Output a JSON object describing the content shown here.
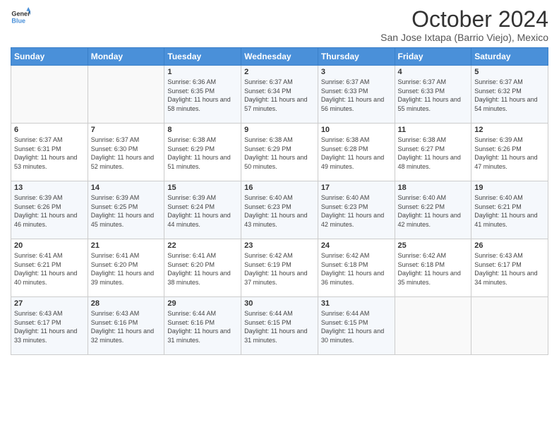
{
  "header": {
    "logo_line1": "General",
    "logo_line2": "Blue",
    "title": "October 2024",
    "subtitle": "San Jose Ixtapa (Barrio Viejo), Mexico"
  },
  "days_of_week": [
    "Sunday",
    "Monday",
    "Tuesday",
    "Wednesday",
    "Thursday",
    "Friday",
    "Saturday"
  ],
  "weeks": [
    [
      {
        "day": "",
        "sunrise": "",
        "sunset": "",
        "daylight": ""
      },
      {
        "day": "",
        "sunrise": "",
        "sunset": "",
        "daylight": ""
      },
      {
        "day": "1",
        "sunrise": "Sunrise: 6:36 AM",
        "sunset": "Sunset: 6:35 PM",
        "daylight": "Daylight: 11 hours and 58 minutes."
      },
      {
        "day": "2",
        "sunrise": "Sunrise: 6:37 AM",
        "sunset": "Sunset: 6:34 PM",
        "daylight": "Daylight: 11 hours and 57 minutes."
      },
      {
        "day": "3",
        "sunrise": "Sunrise: 6:37 AM",
        "sunset": "Sunset: 6:33 PM",
        "daylight": "Daylight: 11 hours and 56 minutes."
      },
      {
        "day": "4",
        "sunrise": "Sunrise: 6:37 AM",
        "sunset": "Sunset: 6:33 PM",
        "daylight": "Daylight: 11 hours and 55 minutes."
      },
      {
        "day": "5",
        "sunrise": "Sunrise: 6:37 AM",
        "sunset": "Sunset: 6:32 PM",
        "daylight": "Daylight: 11 hours and 54 minutes."
      }
    ],
    [
      {
        "day": "6",
        "sunrise": "Sunrise: 6:37 AM",
        "sunset": "Sunset: 6:31 PM",
        "daylight": "Daylight: 11 hours and 53 minutes."
      },
      {
        "day": "7",
        "sunrise": "Sunrise: 6:37 AM",
        "sunset": "Sunset: 6:30 PM",
        "daylight": "Daylight: 11 hours and 52 minutes."
      },
      {
        "day": "8",
        "sunrise": "Sunrise: 6:38 AM",
        "sunset": "Sunset: 6:29 PM",
        "daylight": "Daylight: 11 hours and 51 minutes."
      },
      {
        "day": "9",
        "sunrise": "Sunrise: 6:38 AM",
        "sunset": "Sunset: 6:29 PM",
        "daylight": "Daylight: 11 hours and 50 minutes."
      },
      {
        "day": "10",
        "sunrise": "Sunrise: 6:38 AM",
        "sunset": "Sunset: 6:28 PM",
        "daylight": "Daylight: 11 hours and 49 minutes."
      },
      {
        "day": "11",
        "sunrise": "Sunrise: 6:38 AM",
        "sunset": "Sunset: 6:27 PM",
        "daylight": "Daylight: 11 hours and 48 minutes."
      },
      {
        "day": "12",
        "sunrise": "Sunrise: 6:39 AM",
        "sunset": "Sunset: 6:26 PM",
        "daylight": "Daylight: 11 hours and 47 minutes."
      }
    ],
    [
      {
        "day": "13",
        "sunrise": "Sunrise: 6:39 AM",
        "sunset": "Sunset: 6:26 PM",
        "daylight": "Daylight: 11 hours and 46 minutes."
      },
      {
        "day": "14",
        "sunrise": "Sunrise: 6:39 AM",
        "sunset": "Sunset: 6:25 PM",
        "daylight": "Daylight: 11 hours and 45 minutes."
      },
      {
        "day": "15",
        "sunrise": "Sunrise: 6:39 AM",
        "sunset": "Sunset: 6:24 PM",
        "daylight": "Daylight: 11 hours and 44 minutes."
      },
      {
        "day": "16",
        "sunrise": "Sunrise: 6:40 AM",
        "sunset": "Sunset: 6:23 PM",
        "daylight": "Daylight: 11 hours and 43 minutes."
      },
      {
        "day": "17",
        "sunrise": "Sunrise: 6:40 AM",
        "sunset": "Sunset: 6:23 PM",
        "daylight": "Daylight: 11 hours and 42 minutes."
      },
      {
        "day": "18",
        "sunrise": "Sunrise: 6:40 AM",
        "sunset": "Sunset: 6:22 PM",
        "daylight": "Daylight: 11 hours and 42 minutes."
      },
      {
        "day": "19",
        "sunrise": "Sunrise: 6:40 AM",
        "sunset": "Sunset: 6:21 PM",
        "daylight": "Daylight: 11 hours and 41 minutes."
      }
    ],
    [
      {
        "day": "20",
        "sunrise": "Sunrise: 6:41 AM",
        "sunset": "Sunset: 6:21 PM",
        "daylight": "Daylight: 11 hours and 40 minutes."
      },
      {
        "day": "21",
        "sunrise": "Sunrise: 6:41 AM",
        "sunset": "Sunset: 6:20 PM",
        "daylight": "Daylight: 11 hours and 39 minutes."
      },
      {
        "day": "22",
        "sunrise": "Sunrise: 6:41 AM",
        "sunset": "Sunset: 6:20 PM",
        "daylight": "Daylight: 11 hours and 38 minutes."
      },
      {
        "day": "23",
        "sunrise": "Sunrise: 6:42 AM",
        "sunset": "Sunset: 6:19 PM",
        "daylight": "Daylight: 11 hours and 37 minutes."
      },
      {
        "day": "24",
        "sunrise": "Sunrise: 6:42 AM",
        "sunset": "Sunset: 6:18 PM",
        "daylight": "Daylight: 11 hours and 36 minutes."
      },
      {
        "day": "25",
        "sunrise": "Sunrise: 6:42 AM",
        "sunset": "Sunset: 6:18 PM",
        "daylight": "Daylight: 11 hours and 35 minutes."
      },
      {
        "day": "26",
        "sunrise": "Sunrise: 6:43 AM",
        "sunset": "Sunset: 6:17 PM",
        "daylight": "Daylight: 11 hours and 34 minutes."
      }
    ],
    [
      {
        "day": "27",
        "sunrise": "Sunrise: 6:43 AM",
        "sunset": "Sunset: 6:17 PM",
        "daylight": "Daylight: 11 hours and 33 minutes."
      },
      {
        "day": "28",
        "sunrise": "Sunrise: 6:43 AM",
        "sunset": "Sunset: 6:16 PM",
        "daylight": "Daylight: 11 hours and 32 minutes."
      },
      {
        "day": "29",
        "sunrise": "Sunrise: 6:44 AM",
        "sunset": "Sunset: 6:16 PM",
        "daylight": "Daylight: 11 hours and 31 minutes."
      },
      {
        "day": "30",
        "sunrise": "Sunrise: 6:44 AM",
        "sunset": "Sunset: 6:15 PM",
        "daylight": "Daylight: 11 hours and 31 minutes."
      },
      {
        "day": "31",
        "sunrise": "Sunrise: 6:44 AM",
        "sunset": "Sunset: 6:15 PM",
        "daylight": "Daylight: 11 hours and 30 minutes."
      },
      {
        "day": "",
        "sunrise": "",
        "sunset": "",
        "daylight": ""
      },
      {
        "day": "",
        "sunrise": "",
        "sunset": "",
        "daylight": ""
      }
    ]
  ]
}
